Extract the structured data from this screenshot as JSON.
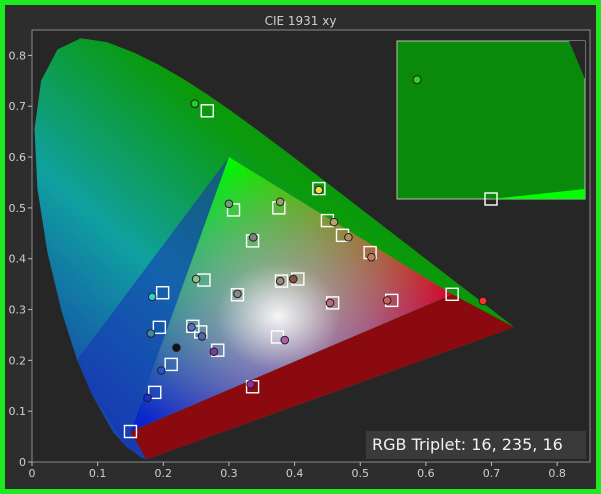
{
  "window": {
    "title": "CIE 1931 xy",
    "border_color": "#1ee81e",
    "background_color": "#2d2d2d"
  },
  "readout": {
    "text": "RGB Triplet: 16, 235, 16"
  },
  "chart_data": {
    "type": "scatter",
    "title": "CIE 1931 xy",
    "xlabel": "",
    "ylabel": "",
    "xlim": [
      0,
      0.85
    ],
    "ylim": [
      0,
      0.85
    ],
    "x_ticks": [
      0,
      0.1,
      0.2,
      0.3,
      0.4,
      0.5,
      0.6,
      0.7,
      0.8
    ],
    "y_ticks": [
      0,
      0.1,
      0.2,
      0.3,
      0.4,
      0.5,
      0.6,
      0.7,
      0.8
    ],
    "x_tick_labels": [
      "0",
      "0.1",
      "0.2",
      "0.3",
      "0.4",
      "0.5",
      "0.6",
      "0.7",
      "0.8"
    ],
    "y_tick_labels": [
      "0",
      "0.1",
      "0.2",
      "0.3",
      "0.4",
      "0.5",
      "0.6",
      "0.7",
      "0.8"
    ],
    "gamut_triangle": {
      "red": [
        0.64,
        0.33
      ],
      "green": [
        0.3,
        0.6
      ],
      "blue": [
        0.15,
        0.06
      ]
    },
    "spectral_locus": [
      [
        0.1741,
        0.005
      ],
      [
        0.1666,
        0.0089
      ],
      [
        0.144,
        0.0297
      ],
      [
        0.1241,
        0.0578
      ],
      [
        0.0913,
        0.1327
      ],
      [
        0.0687,
        0.2007
      ],
      [
        0.0454,
        0.295
      ],
      [
        0.0235,
        0.4127
      ],
      [
        0.0082,
        0.5384
      ],
      [
        0.0039,
        0.6548
      ],
      [
        0.0139,
        0.7502
      ],
      [
        0.0389,
        0.812
      ],
      [
        0.0743,
        0.8338
      ],
      [
        0.1142,
        0.8262
      ],
      [
        0.1547,
        0.8059
      ],
      [
        0.1929,
        0.7816
      ],
      [
        0.2296,
        0.7543
      ],
      [
        0.2658,
        0.7243
      ],
      [
        0.3016,
        0.6923
      ],
      [
        0.3373,
        0.6589
      ],
      [
        0.3731,
        0.6245
      ],
      [
        0.4087,
        0.5896
      ],
      [
        0.4441,
        0.5547
      ],
      [
        0.4788,
        0.5202
      ],
      [
        0.5125,
        0.4866
      ],
      [
        0.5448,
        0.4544
      ],
      [
        0.5752,
        0.4242
      ],
      [
        0.6029,
        0.3965
      ],
      [
        0.627,
        0.3725
      ],
      [
        0.6482,
        0.3514
      ],
      [
        0.6658,
        0.334
      ],
      [
        0.6801,
        0.3197
      ],
      [
        0.6915,
        0.3083
      ],
      [
        0.7006,
        0.2993
      ],
      [
        0.7079,
        0.292
      ],
      [
        0.714,
        0.2859
      ],
      [
        0.719,
        0.2809
      ],
      [
        0.723,
        0.277
      ],
      [
        0.726,
        0.274
      ],
      [
        0.7283,
        0.2717
      ],
      [
        0.7347,
        0.2653
      ]
    ],
    "target_points": [
      {
        "x": 0.15,
        "y": 0.06
      },
      {
        "x": 0.187,
        "y": 0.137
      },
      {
        "x": 0.212,
        "y": 0.192
      },
      {
        "x": 0.257,
        "y": 0.256
      },
      {
        "x": 0.283,
        "y": 0.22
      },
      {
        "x": 0.245,
        "y": 0.267
      },
      {
        "x": 0.194,
        "y": 0.265
      },
      {
        "x": 0.199,
        "y": 0.333
      },
      {
        "x": 0.262,
        "y": 0.358
      },
      {
        "x": 0.313,
        "y": 0.329
      },
      {
        "x": 0.336,
        "y": 0.148
      },
      {
        "x": 0.374,
        "y": 0.246
      },
      {
        "x": 0.458,
        "y": 0.313
      },
      {
        "x": 0.548,
        "y": 0.318
      },
      {
        "x": 0.64,
        "y": 0.33
      },
      {
        "x": 0.38,
        "y": 0.356
      },
      {
        "x": 0.405,
        "y": 0.36
      },
      {
        "x": 0.515,
        "y": 0.412
      },
      {
        "x": 0.473,
        "y": 0.446
      },
      {
        "x": 0.45,
        "y": 0.475
      },
      {
        "x": 0.437,
        "y": 0.538
      },
      {
        "x": 0.376,
        "y": 0.5
      },
      {
        "x": 0.336,
        "y": 0.435
      },
      {
        "x": 0.307,
        "y": 0.496
      },
      {
        "x": 0.267,
        "y": 0.691
      }
    ],
    "measured_points": [
      {
        "x": 0.176,
        "y": 0.126,
        "color": "#1a2fd0"
      },
      {
        "x": 0.197,
        "y": 0.18,
        "color": "#2a4fd0"
      },
      {
        "x": 0.22,
        "y": 0.225,
        "color": "#111111"
      },
      {
        "x": 0.243,
        "y": 0.265,
        "color": "#5a70c8"
      },
      {
        "x": 0.259,
        "y": 0.247,
        "color": "#4f66b8"
      },
      {
        "x": 0.277,
        "y": 0.217,
        "color": "#7a3aa0"
      },
      {
        "x": 0.181,
        "y": 0.253,
        "color": "#3e8aa8"
      },
      {
        "x": 0.183,
        "y": 0.325,
        "color": "#2ecde0"
      },
      {
        "x": 0.25,
        "y": 0.36,
        "color": "#8dbf8d"
      },
      {
        "x": 0.313,
        "y": 0.331,
        "color": "#8a8a8a"
      },
      {
        "x": 0.333,
        "y": 0.153,
        "color": "#9a2aa0"
      },
      {
        "x": 0.385,
        "y": 0.24,
        "color": "#b85ab0"
      },
      {
        "x": 0.454,
        "y": 0.313,
        "color": "#c06a78"
      },
      {
        "x": 0.541,
        "y": 0.318,
        "color": "#d06060"
      },
      {
        "x": 0.687,
        "y": 0.317,
        "color": "#ff3030"
      },
      {
        "x": 0.378,
        "y": 0.356,
        "color": "#a08878"
      },
      {
        "x": 0.398,
        "y": 0.36,
        "color": "#905040"
      },
      {
        "x": 0.517,
        "y": 0.403,
        "color": "#c08060"
      },
      {
        "x": 0.482,
        "y": 0.442,
        "color": "#b09060"
      },
      {
        "x": 0.46,
        "y": 0.472,
        "color": "#b8a070"
      },
      {
        "x": 0.437,
        "y": 0.535,
        "color": "#e8e040"
      },
      {
        "x": 0.378,
        "y": 0.512,
        "color": "#9aa060"
      },
      {
        "x": 0.337,
        "y": 0.442,
        "color": "#808080"
      },
      {
        "x": 0.3,
        "y": 0.508,
        "color": "#70a070"
      },
      {
        "x": 0.248,
        "y": 0.705,
        "color": "#20d020"
      }
    ],
    "inset": {
      "xlim": [
        0.24,
        0.36
      ],
      "ylim": [
        0.6,
        0.8
      ],
      "measured_point": {
        "x": 0.2528,
        "y": 0.751
      },
      "target_point": {
        "x": 0.3,
        "y": 0.6
      }
    }
  }
}
